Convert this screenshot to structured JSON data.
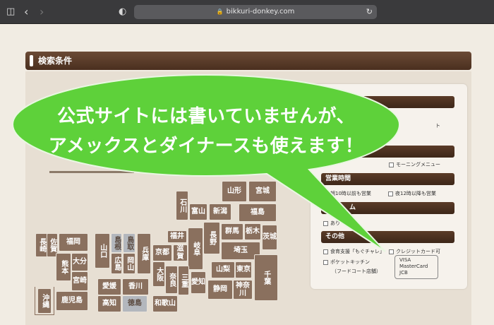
{
  "browser": {
    "url": "bikkuri-donkey.com",
    "sidebar_icon": "sidebar-icon",
    "back_icon": "back-icon",
    "forward_icon": "forward-icon",
    "shield_icon": "shield-icon",
    "lock_icon": "lock-icon",
    "reload_icon": "reload-icon"
  },
  "page": {
    "title": "検索条件",
    "colors": {
      "brown": "#4a2f1f",
      "pref": "#8a705e",
      "bubble": "#5ed13a"
    }
  },
  "map": {
    "prefectures": [
      {
        "key": "yamagata",
        "label": "山形"
      },
      {
        "key": "miyagi",
        "label": "宮城"
      },
      {
        "key": "ishikawa",
        "label": "石川"
      },
      {
        "key": "toyama",
        "label": "富山"
      },
      {
        "key": "niigata",
        "label": "新潟"
      },
      {
        "key": "fukushima",
        "label": "福島"
      },
      {
        "key": "fukui",
        "label": "福井"
      },
      {
        "key": "nagano",
        "label": "長野"
      },
      {
        "key": "gunma",
        "label": "群馬"
      },
      {
        "key": "tochigi",
        "label": "栃木"
      },
      {
        "key": "ibaraki",
        "label": "茨城"
      },
      {
        "key": "gifu",
        "label": "岐阜"
      },
      {
        "key": "saitama",
        "label": "埼玉"
      },
      {
        "key": "nagasaki",
        "label": "長崎"
      },
      {
        "key": "saga",
        "label": "佐賀"
      },
      {
        "key": "fukuoka",
        "label": "福岡"
      },
      {
        "key": "yamaguchi",
        "label": "山口"
      },
      {
        "key": "shimane",
        "label": "島根"
      },
      {
        "key": "tottori",
        "label": "鳥取"
      },
      {
        "key": "hyogo",
        "label": "兵庫"
      },
      {
        "key": "kyoto",
        "label": "京都"
      },
      {
        "key": "shiga",
        "label": "滋賀"
      },
      {
        "key": "kumamoto",
        "label": "熊本"
      },
      {
        "key": "oita",
        "label": "大分"
      },
      {
        "key": "hiroshima",
        "label": "広島"
      },
      {
        "key": "okayama",
        "label": "岡山"
      },
      {
        "key": "osaka",
        "label": "大阪"
      },
      {
        "key": "nara",
        "label": "奈良"
      },
      {
        "key": "mie",
        "label": "三重"
      },
      {
        "key": "aichi",
        "label": "愛知"
      },
      {
        "key": "yamanashi",
        "label": "山梨"
      },
      {
        "key": "tokyo",
        "label": "東京"
      },
      {
        "key": "chiba",
        "label": "千葉"
      },
      {
        "key": "miyazaki",
        "label": "宮崎"
      },
      {
        "key": "ehime",
        "label": "愛媛"
      },
      {
        "key": "kagawa",
        "label": "香川"
      },
      {
        "key": "shizuoka",
        "label": "静岡"
      },
      {
        "key": "kanagawa",
        "label": "神奈川"
      },
      {
        "key": "okinawa",
        "label": "沖縄"
      },
      {
        "key": "kagoshima",
        "label": "鹿児島"
      },
      {
        "key": "kochi",
        "label": "高知"
      },
      {
        "key": "tokushima",
        "label": "徳島"
      },
      {
        "key": "wakayama",
        "label": "和歌山"
      }
    ]
  },
  "panel": {
    "morning_label": "モーニングメニュー",
    "hours_title": "営業時間",
    "before10_label": "朝10時以前も営業",
    "after12_label": "夜12時以降も営業",
    "section3_title_partial": "ム",
    "option_partial": "あり",
    "other_title": "その他",
    "shokuiku_label": "食育支援「もぐチャレ」",
    "credit_label": "クレジットカード可",
    "pocket_label": "ポケットキッチン",
    "foodcourt_label": "（フードコート店舗）",
    "card_brands": [
      "VISA",
      "MasterCard",
      "JCB"
    ],
    "partial_edge_text": "ト"
  },
  "callout": {
    "line1": "公式サイトには書いていませんが、",
    "line2": "アメックスとダイナースも使えます！"
  }
}
